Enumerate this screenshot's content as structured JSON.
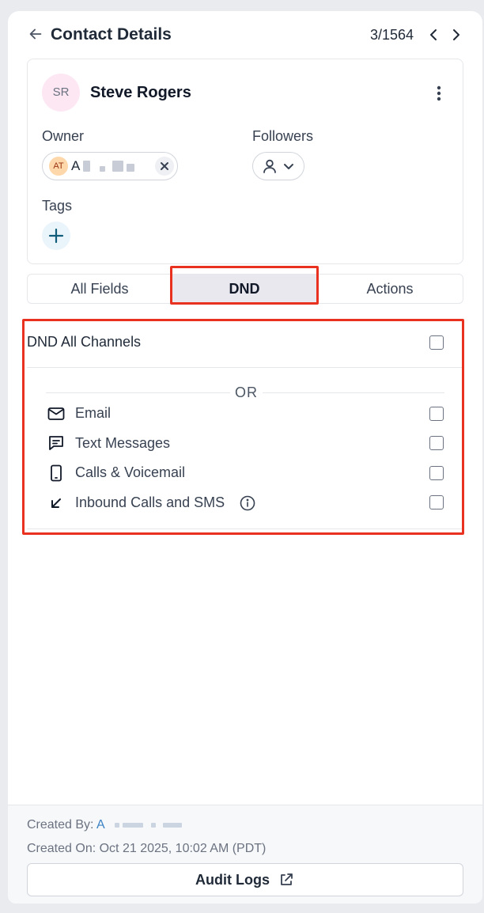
{
  "header": {
    "title": "Contact Details",
    "position": "3/1564"
  },
  "contact": {
    "initials": "SR",
    "name": "Steve Rogers"
  },
  "owner": {
    "label": "Owner",
    "initials": "AT",
    "name_visible": "A"
  },
  "followers": {
    "label": "Followers"
  },
  "tags": {
    "label": "Tags"
  },
  "tabs": [
    {
      "label": "All Fields",
      "active": false
    },
    {
      "label": "DND",
      "active": true
    },
    {
      "label": "Actions",
      "active": false
    }
  ],
  "dnd": {
    "all_channels_label": "DND All Channels",
    "all_channels_checked": false,
    "or_label": "OR",
    "channels": [
      {
        "label": "Email",
        "icon": "mail-icon",
        "checked": false
      },
      {
        "label": "Text Messages",
        "icon": "chat-icon",
        "checked": false
      },
      {
        "label": "Calls & Voicemail",
        "icon": "phone-icon",
        "checked": false
      },
      {
        "label": "Inbound Calls and SMS",
        "icon": "arrow-down-left-icon",
        "checked": false
      }
    ]
  },
  "footer": {
    "created_by_label": "Created By:",
    "created_by_value": "A",
    "created_on_label": "Created On:",
    "created_on_value": "Oct 21 2025, 10:02 AM (PDT)",
    "audit_button": "Audit Logs"
  },
  "colors": {
    "highlight": "#e8321f",
    "accent_blue": "#3b82c4",
    "avatar_pink": "#fde7f3",
    "avatar_orange": "#fed7aa",
    "active_tab_bg": "#e8e8ee"
  }
}
